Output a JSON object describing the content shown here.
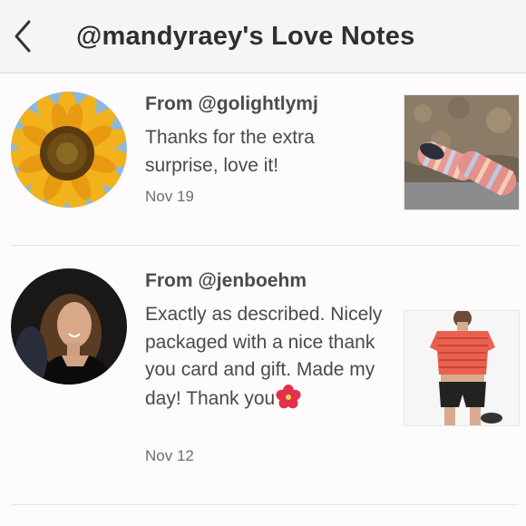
{
  "header": {
    "title": "@mandyraey's Love Notes",
    "back_icon": "chevron-left-icon"
  },
  "notes": [
    {
      "from": "From @golightlymj",
      "message": "Thanks for the extra surprise, love it!",
      "date": "Nov 19",
      "avatar": "sunflower-avatar",
      "thumbnail": "striped-slip-on-shoes"
    },
    {
      "from": "From @jenboehm",
      "message": "Exactly as described. Nicely packaged with a nice thank you card and gift. Made my day! Thank you",
      "emoji": "hibiscus-icon",
      "date": "Nov 12",
      "avatar": "woman-portrait-avatar",
      "thumbnail": "striped-crop-top-outfit"
    }
  ],
  "colors": {
    "header_bg": "#f6f4f5",
    "text": "#4a4a4a",
    "date": "#6f6f6f",
    "divider": "#e6e3e4"
  }
}
